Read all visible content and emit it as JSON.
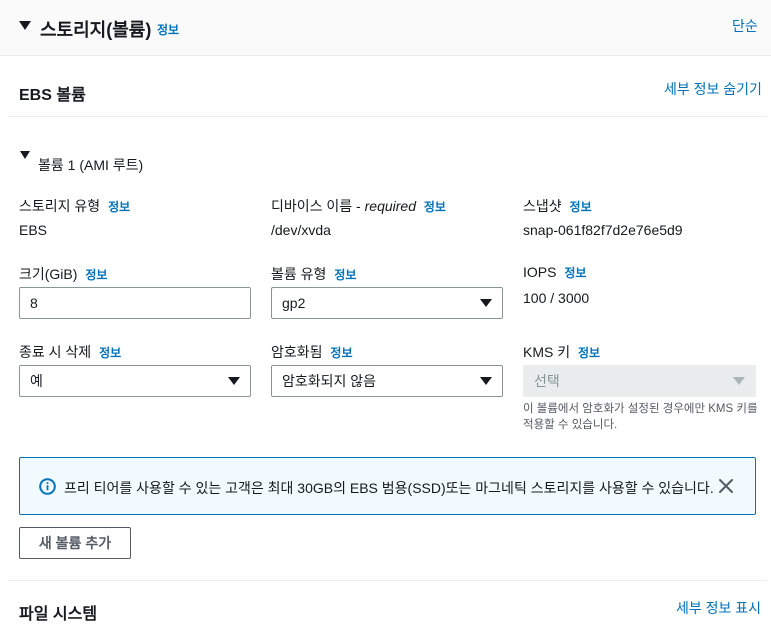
{
  "section": {
    "title": "스토리지(볼륨)",
    "info": "정보",
    "mode_link": "단순"
  },
  "ebs": {
    "title": "EBS 볼륨",
    "toggle_link": "세부 정보 숨기기"
  },
  "volume": {
    "header": "볼륨 1 (AMI 루트)",
    "storage_type": {
      "label": "스토리지 유형",
      "info": "정보",
      "value": "EBS"
    },
    "device_name": {
      "label_main": "디바이스 이름 - ",
      "label_req": "required",
      "info": "정보",
      "value": "/dev/xvda"
    },
    "snapshot": {
      "label": "스냅샷",
      "info": "정보",
      "value": "snap-061f82f7d2e76e5d9"
    },
    "size": {
      "label": "크기(GiB)",
      "info": "정보",
      "value": "8"
    },
    "volume_type": {
      "label": "볼륨 유형",
      "info": "정보",
      "value": "gp2"
    },
    "iops": {
      "label": "IOPS",
      "info": "정보",
      "value": "100 / 3000"
    },
    "delete_on_termination": {
      "label": "종료 시 삭제",
      "info": "정보",
      "value": "예"
    },
    "encrypted": {
      "label": "암호화됨",
      "info": "정보",
      "value": "암호화되지 않음"
    },
    "kms_key": {
      "label": "KMS 키",
      "info": "정보",
      "placeholder": "선택",
      "hint_line1": "이 볼륨에서 암호화가 설정된 경우에만 KMS 키를",
      "hint_line2": "적용할 수 있습니다."
    }
  },
  "alert": {
    "text": "프리 티어를 사용할 수 있는 고객은 최대 30GB의 EBS 범용(SSD)또는 마그네틱 스토리지를 사용할 수 있습니다."
  },
  "add_volume_button": "새 볼륨 추가",
  "filesystem": {
    "title": "파일 시스템",
    "toggle_link": "세부 정보 표시"
  },
  "colors": {
    "link": "#0073bb",
    "alert_bg": "#f1faff",
    "alert_border": "#0073bb"
  }
}
